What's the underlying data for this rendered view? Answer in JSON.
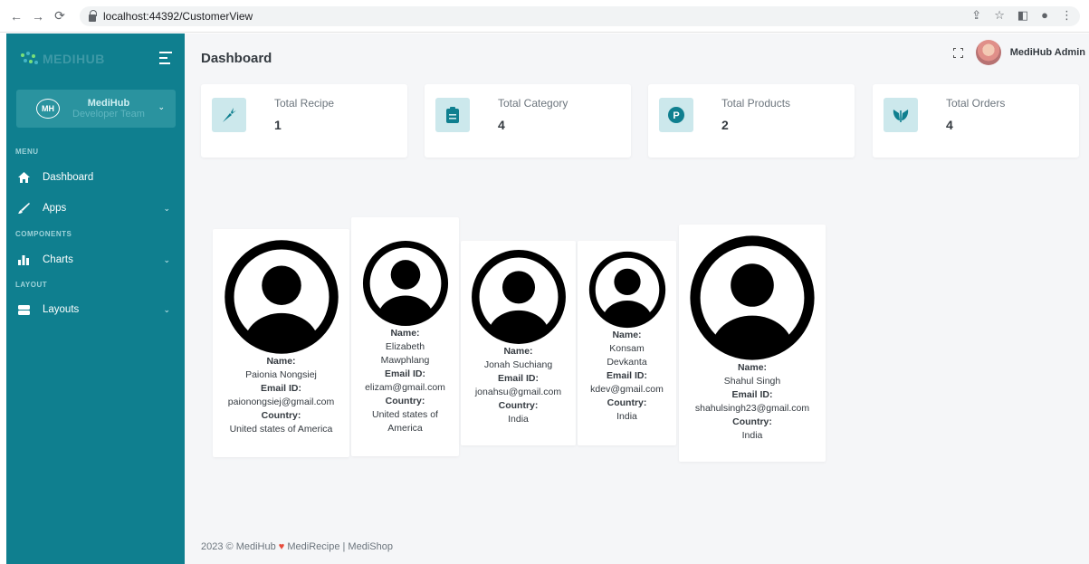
{
  "browser": {
    "url": "localhost:44392/CustomerView",
    "back_icon": "arrow-left-icon",
    "forward_icon": "arrow-right-icon",
    "reload_icon": "reload-icon"
  },
  "sidebar": {
    "brand": "MEDIHUB",
    "user_name": "MediHub",
    "user_role": "Developer Team",
    "user_initials": "MH",
    "sections": {
      "menu": "MENU",
      "components": "COMPONENTS",
      "layout": "LAYOUT"
    },
    "items": [
      {
        "label": "Dashboard",
        "icon": "home-icon"
      },
      {
        "label": "Apps",
        "icon": "brush-icon"
      },
      {
        "label": "Charts",
        "icon": "bar-chart-icon"
      },
      {
        "label": "Layouts",
        "icon": "layers-icon"
      }
    ]
  },
  "header": {
    "title": "Dashboard",
    "admin_name": "MediHub Admin"
  },
  "stats": [
    {
      "label": "Total Recipe",
      "value": "1",
      "icon": "carrot-icon"
    },
    {
      "label": "Total Category",
      "value": "4",
      "icon": "clipboard-icon"
    },
    {
      "label": "Total Products",
      "value": "2",
      "icon": "product-p-icon"
    },
    {
      "label": "Total Orders",
      "value": "4",
      "icon": "emblem-icon"
    }
  ],
  "customers": [
    {
      "name": "Paionia Nongsiej",
      "email": "paionongsiej@gmail.com",
      "country": "United states of America"
    },
    {
      "name": "Elizabeth Mawphlang",
      "email": "elizam@gmail.com",
      "country": "United states of America"
    },
    {
      "name": "Jonah Suchiang",
      "email": "jonahsu@gmail.com",
      "country": "India"
    },
    {
      "name": "Konsam Devkanta",
      "email": "kdev@gmail.com",
      "country": "India"
    },
    {
      "name": "Shahul Singh",
      "email": "shahulsingh23@gmail.com",
      "country": "India"
    }
  ],
  "labels": {
    "name": "Name:",
    "email": "Email ID:",
    "country": "Country:"
  },
  "footer": {
    "prefix": "2023 © MediHub",
    "suffix": "MediRecipe | MediShop"
  },
  "colors": {
    "sidebar": "#0f7f8f",
    "accent": "#0f7f8f",
    "icon_bg": "#cce8ec"
  }
}
